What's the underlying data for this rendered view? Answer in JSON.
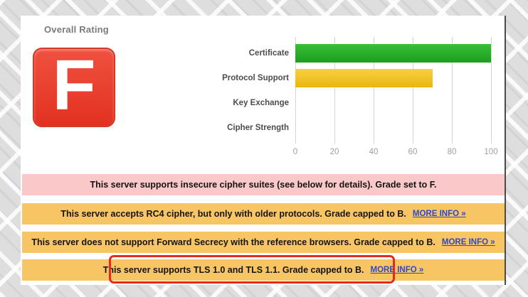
{
  "rating": {
    "label": "Overall Rating",
    "grade": "F"
  },
  "chart_data": {
    "type": "bar",
    "orientation": "horizontal",
    "title": "",
    "categories": [
      "Certificate",
      "Protocol Support",
      "Key Exchange",
      "Cipher Strength"
    ],
    "values": [
      100,
      70,
      0,
      0
    ],
    "xlim": [
      0,
      100
    ],
    "xticks": [
      0,
      20,
      40,
      60,
      80,
      100
    ],
    "grid": true,
    "legend": false,
    "bar_styles": [
      {
        "color_top": "#3abf3a",
        "color_bottom": "#1d9e1d"
      },
      {
        "color_top": "#f7cf45",
        "color_bottom": "#eab70e"
      },
      null,
      null
    ]
  },
  "messages": [
    {
      "severity": "error",
      "text": "This server supports insecure cipher suites (see below for details). Grade set to F.",
      "link": "",
      "highlighted": false
    },
    {
      "severity": "warning",
      "text": "This server accepts RC4 cipher, but only with older protocols. Grade capped to B.",
      "link": "MORE INFO »",
      "highlighted": false
    },
    {
      "severity": "warning",
      "text": "This server does not support Forward Secrecy with the reference browsers. Grade capped to B.",
      "link": "MORE INFO »",
      "highlighted": false
    },
    {
      "severity": "warning",
      "text": "This server supports TLS 1.0 and TLS 1.1. Grade capped to B.",
      "link": "MORE INFO »",
      "highlighted": true
    }
  ],
  "colors": {
    "error_bg": "#fac8c8",
    "warning_bg": "#f8c565",
    "link": "#2b49c9",
    "grade_badge_red": "#e8402b",
    "annotation_outline": "#e42b1e",
    "bar_green": "#28ae28",
    "bar_yellow": "#f0c322"
  }
}
